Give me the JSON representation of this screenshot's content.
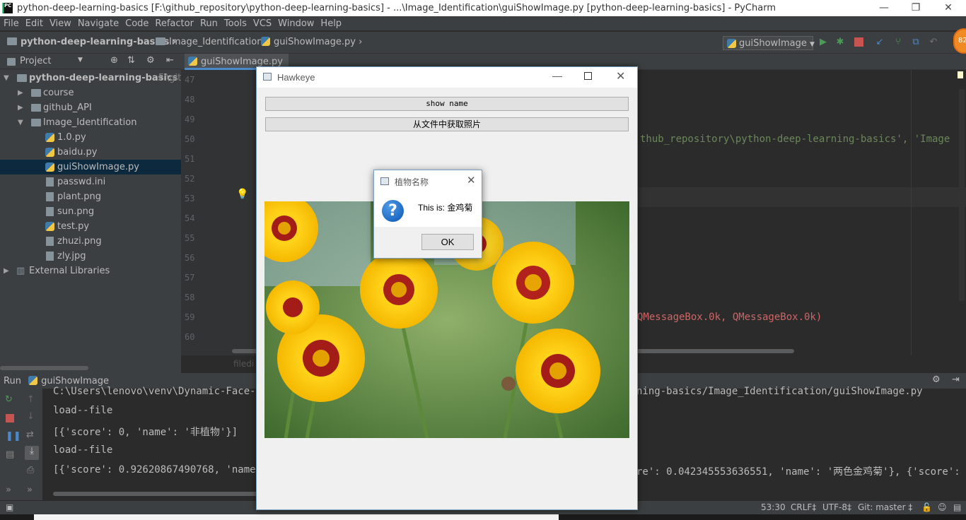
{
  "window": {
    "title": "python-deep-learning-basics [F:\\github_repository\\python-deep-learning-basics] - ...\\Image_Identification\\guiShowImage.py [python-deep-learning-basics] - PyCharm",
    "app_icon": "PC",
    "controls": {
      "minimize": "—",
      "restore": "❐",
      "close": "✕"
    }
  },
  "menu": [
    "File",
    "Edit",
    "View",
    "Navigate",
    "Code",
    "Refactor",
    "Run",
    "Tools",
    "VCS",
    "Window",
    "Help"
  ],
  "breadcrumb": [
    "python-deep-learning-basics",
    "Image_Identification",
    "guiShowImage.py"
  ],
  "run_config": "guiShowImage",
  "avatar_text": "82",
  "project": {
    "header": "Project",
    "root": "python-deep-learning-basics",
    "root_path": "F:\\git",
    "items": [
      {
        "label": "course",
        "type": "folder"
      },
      {
        "label": "github_API",
        "type": "folder"
      },
      {
        "label": "Image_Identification",
        "type": "folder"
      },
      {
        "label": "1.0.py",
        "type": "py"
      },
      {
        "label": "baidu.py",
        "type": "py"
      },
      {
        "label": "guiShowImage.py",
        "type": "py"
      },
      {
        "label": "passwd.ini",
        "type": "file"
      },
      {
        "label": "plant.png",
        "type": "file"
      },
      {
        "label": "sun.png",
        "type": "file"
      },
      {
        "label": "test.py",
        "type": "py"
      },
      {
        "label": "zhuzi.png",
        "type": "file"
      },
      {
        "label": "zly.jpg",
        "type": "file"
      }
    ],
    "external": "External Libraries"
  },
  "editor": {
    "tab": "guiShowImage.py",
    "line_numbers": [
      "47",
      "48",
      "49",
      "50",
      "51",
      "52",
      "53",
      "54",
      "55",
      "56",
      "57",
      "58",
      "59",
      "60"
    ],
    "code_line_50": "thub_repository\\python-deep-learning-basics', 'Image",
    "code_line_59": "QMessageBox.0k, QMessageBox.0k)",
    "hidden_tab_fragment": "filedi"
  },
  "run": {
    "label": "Run",
    "config": "guiShowImage",
    "lines": [
      "C:\\Users\\lenovo\\venv\\Dynamic-Face-Re",
      "load--file",
      "[{'score': 0, 'name': '非植物'}]",
      "load--file",
      "[{'score': 0.92620867490768, 'name':"
    ],
    "line0_right": "ning-basics/Image_Identification/guiShowImage.py",
    "line4_right": "re': 0.042345553636551, 'name': '两色金鸡菊'}, {'score': 0."
  },
  "status": {
    "position": "53:30",
    "line_sep": "CRLF‡",
    "encoding": "UTF-8‡",
    "vcs": "Git: master ‡"
  },
  "hawkeye": {
    "title": "Hawkeye",
    "btn_show_name": "show name",
    "btn_load": "从文件中获取照片"
  },
  "dialog": {
    "title": "植物名称",
    "message": "This is: 金鸡菊",
    "ok": "OK",
    "icon": "question-icon"
  },
  "colors": {
    "accent": "#4a88c7",
    "run_green": "#499c54",
    "stop_red": "#c75450"
  }
}
